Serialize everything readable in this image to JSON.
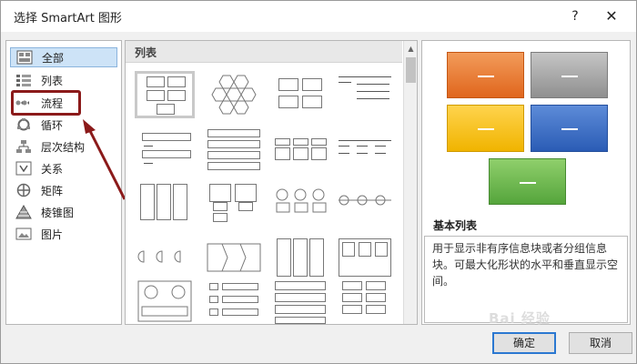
{
  "window": {
    "title": "选择 SmartArt 图形",
    "help_glyph": "?",
    "close_glyph": "✕"
  },
  "categories": [
    {
      "label": "全部",
      "icon": "all-icon",
      "selected": true
    },
    {
      "label": "列表",
      "icon": "list-icon",
      "selected": false
    },
    {
      "label": "流程",
      "icon": "process-icon",
      "selected": false
    },
    {
      "label": "循环",
      "icon": "cycle-icon",
      "selected": false
    },
    {
      "label": "层次结构",
      "icon": "hierarchy-icon",
      "selected": false
    },
    {
      "label": "关系",
      "icon": "relationship-icon",
      "selected": false
    },
    {
      "label": "矩阵",
      "icon": "matrix-icon",
      "selected": false
    },
    {
      "label": "棱锥图",
      "icon": "pyramid-icon",
      "selected": false
    },
    {
      "label": "图片",
      "icon": "picture-icon",
      "selected": false
    }
  ],
  "gallery": {
    "header": "列表"
  },
  "preview": {
    "layout_name": "基本列表",
    "description": "用于显示非有序信息块或者分组信息块。可最大化形状的水平和垂直显示空间。",
    "colors": {
      "orange": "#e0661d",
      "gray": "#8f8f8f",
      "yellow": "#f0b400",
      "blue": "#2b5cb5",
      "green": "#55a53c"
    }
  },
  "buttons": {
    "ok": "确定",
    "cancel": "取消"
  },
  "annotation": {
    "highlight_color": "#8b1a1a"
  },
  "watermark": "Bai 经验"
}
